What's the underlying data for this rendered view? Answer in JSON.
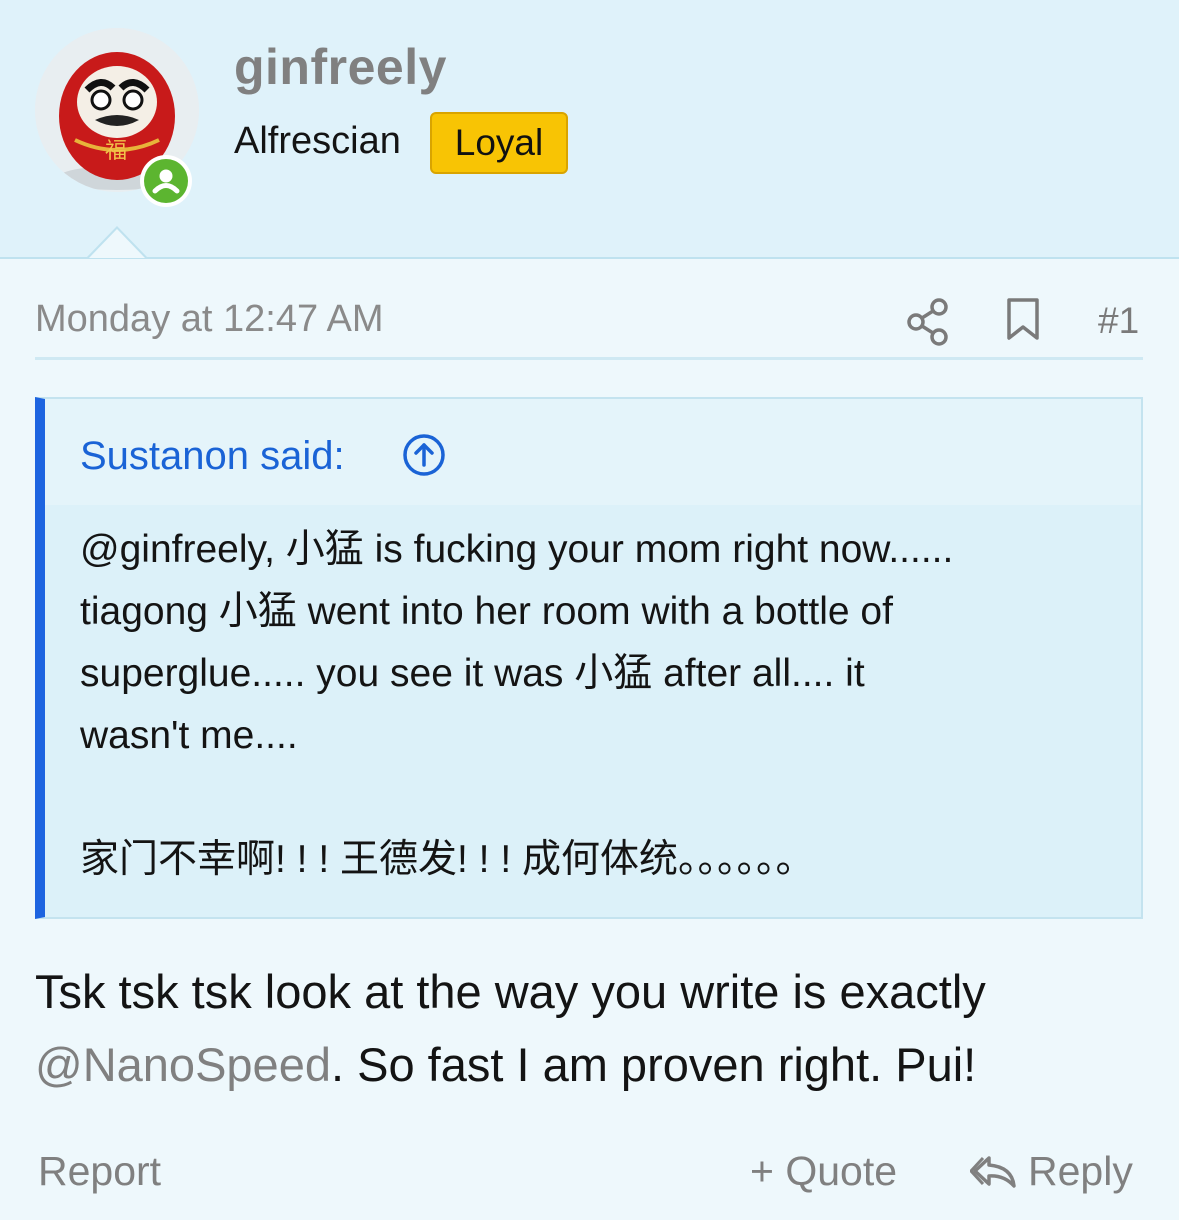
{
  "user": {
    "name": "ginfreely",
    "title": "Alfrescian",
    "badge": "Loyal",
    "avatar_icon": "daruma-avatar",
    "status_icon": "online-user-icon"
  },
  "meta": {
    "date": "Monday at 12:47 AM",
    "post_number": "#1",
    "share_icon": "share-icon",
    "bookmark_icon": "bookmark-icon"
  },
  "quote": {
    "author": "Sustanon said:",
    "lines": [
      "@ginfreely, 小猛 is fucking your mom right now......",
      "tiagong 小猛 went into her room with a bottle of",
      "superglue..... you see it was 小猛 after all.... it",
      "wasn't me....",
      "家门不幸啊! ! ! 王德发! ! ! 成何体统。。。。。。"
    ]
  },
  "message": {
    "line1": "Tsk tsk tsk look at the way you write is exactly",
    "mention": "@NanoSpeed",
    "line2_rest": ". So fast I am proven right. Pui!"
  },
  "footer": {
    "report": "Report",
    "quote": "+ Quote",
    "reply": "Reply"
  },
  "colors": {
    "header_bg": "#dff2fa",
    "accent_blue": "#1d64e0",
    "badge_yellow": "#f8c404",
    "online_green": "#5cb530"
  }
}
